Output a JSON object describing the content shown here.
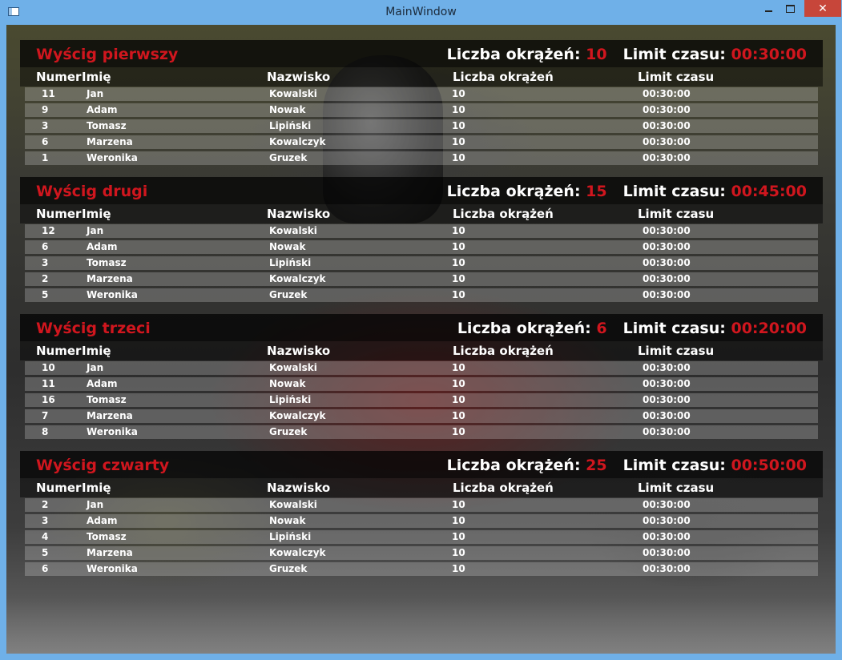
{
  "window": {
    "title": "MainWindow",
    "close_glyph": "✕"
  },
  "columns": {
    "num": "Numer",
    "name": "Imię",
    "surname": "Nazwisko",
    "laps": "Liczba okrążeń",
    "limit": "Limit czasu"
  },
  "meta_labels": {
    "laps": "Liczba okrążeń:",
    "limit": "Limit czasu:"
  },
  "races": [
    {
      "title": "Wyścig pierwszy",
      "laps": "10",
      "limit": "00:30:00",
      "rows": [
        {
          "num": "11",
          "name": "Jan",
          "surname": "Kowalski",
          "laps": "10",
          "limit": "00:30:00"
        },
        {
          "num": "9",
          "name": "Adam",
          "surname": "Nowak",
          "laps": "10",
          "limit": "00:30:00"
        },
        {
          "num": "3",
          "name": "Tomasz",
          "surname": "Lipiński",
          "laps": "10",
          "limit": "00:30:00"
        },
        {
          "num": "6",
          "name": "Marzena",
          "surname": "Kowalczyk",
          "laps": "10",
          "limit": "00:30:00"
        },
        {
          "num": "1",
          "name": "Weronika",
          "surname": "Gruzek",
          "laps": "10",
          "limit": "00:30:00"
        }
      ]
    },
    {
      "title": "Wyścig drugi",
      "laps": "15",
      "limit": "00:45:00",
      "rows": [
        {
          "num": "12",
          "name": "Jan",
          "surname": "Kowalski",
          "laps": "10",
          "limit": "00:30:00"
        },
        {
          "num": "6",
          "name": "Adam",
          "surname": "Nowak",
          "laps": "10",
          "limit": "00:30:00"
        },
        {
          "num": "3",
          "name": "Tomasz",
          "surname": "Lipiński",
          "laps": "10",
          "limit": "00:30:00"
        },
        {
          "num": "2",
          "name": "Marzena",
          "surname": "Kowalczyk",
          "laps": "10",
          "limit": "00:30:00"
        },
        {
          "num": "5",
          "name": "Weronika",
          "surname": "Gruzek",
          "laps": "10",
          "limit": "00:30:00"
        }
      ]
    },
    {
      "title": "Wyścig trzeci",
      "laps": "6",
      "limit": "00:20:00",
      "rows": [
        {
          "num": "10",
          "name": "Jan",
          "surname": "Kowalski",
          "laps": "10",
          "limit": "00:30:00"
        },
        {
          "num": "11",
          "name": "Adam",
          "surname": "Nowak",
          "laps": "10",
          "limit": "00:30:00"
        },
        {
          "num": "16",
          "name": "Tomasz",
          "surname": "Lipiński",
          "laps": "10",
          "limit": "00:30:00"
        },
        {
          "num": "7",
          "name": "Marzena",
          "surname": "Kowalczyk",
          "laps": "10",
          "limit": "00:30:00"
        },
        {
          "num": "8",
          "name": "Weronika",
          "surname": "Gruzek",
          "laps": "10",
          "limit": "00:30:00"
        }
      ]
    },
    {
      "title": "Wyścig czwarty",
      "laps": "25",
      "limit": "00:50:00",
      "rows": [
        {
          "num": "2",
          "name": "Jan",
          "surname": "Kowalski",
          "laps": "10",
          "limit": "00:30:00"
        },
        {
          "num": "3",
          "name": "Adam",
          "surname": "Nowak",
          "laps": "10",
          "limit": "00:30:00"
        },
        {
          "num": "4",
          "name": "Tomasz",
          "surname": "Lipiński",
          "laps": "10",
          "limit": "00:30:00"
        },
        {
          "num": "5",
          "name": "Marzena",
          "surname": "Kowalczyk",
          "laps": "10",
          "limit": "00:30:00"
        },
        {
          "num": "6",
          "name": "Weronika",
          "surname": "Gruzek",
          "laps": "10",
          "limit": "00:30:00"
        }
      ]
    }
  ]
}
